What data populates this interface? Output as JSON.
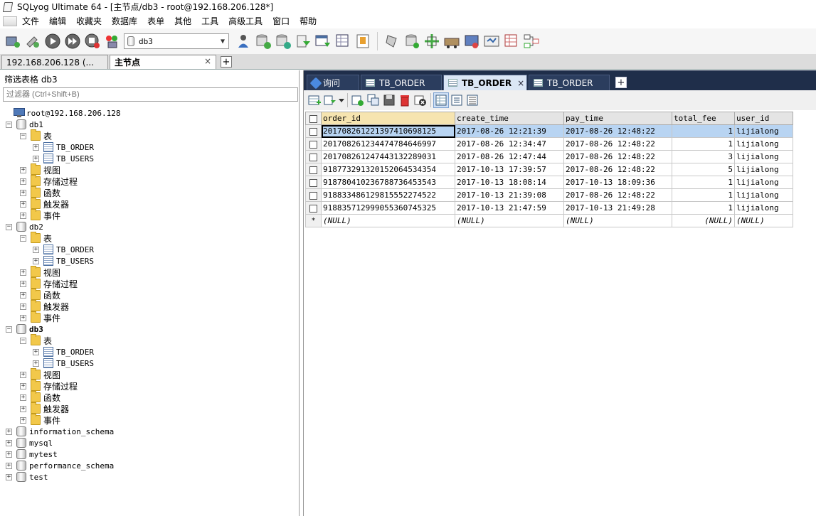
{
  "window": {
    "title": "SQLyog Ultimate 64 - [主节点/db3 - root@192.168.206.128*]"
  },
  "menu": [
    "文件",
    "编辑",
    "收藏夹",
    "数据库",
    "表单",
    "其他",
    "工具",
    "高级工具",
    "窗口",
    "帮助"
  ],
  "toolbar": {
    "db_select": "db3"
  },
  "connection_tabs": [
    {
      "label": "192.168.206.128 (...",
      "active": false
    },
    {
      "label": "主节点",
      "active": true,
      "close": "×"
    }
  ],
  "object_browser": {
    "filter_label": "筛选表格 db3",
    "filter_placeholder": "过滤器 (Ctrl+Shift+B)",
    "root": "root@192.168.206.128",
    "databases": [
      {
        "name": "db1",
        "expanded": true,
        "bold": false
      },
      {
        "name": "db2",
        "expanded": true,
        "bold": false
      },
      {
        "name": "db3",
        "expanded": true,
        "bold": true
      },
      {
        "name": "information_schema",
        "expanded": false
      },
      {
        "name": "mysql",
        "expanded": false
      },
      {
        "name": "mytest",
        "expanded": false
      },
      {
        "name": "performance_schema",
        "expanded": false
      },
      {
        "name": "test",
        "expanded": false
      }
    ],
    "tables_folder": "表",
    "tables": [
      "TB_ORDER",
      "TB_USERS"
    ],
    "folders": [
      "视图",
      "存储过程",
      "函数",
      "触发器",
      "事件"
    ]
  },
  "query_tabs": [
    {
      "label": "询问",
      "type": "query"
    },
    {
      "label": "TB_ORDER",
      "type": "table"
    },
    {
      "label": "TB_ORDER",
      "type": "table",
      "active": true,
      "close": "×"
    },
    {
      "label": "TB_ORDER",
      "type": "table"
    }
  ],
  "grid": {
    "columns": [
      "order_id",
      "create_time",
      "pay_time",
      "total_fee",
      "user_id"
    ],
    "rows": [
      [
        "201708261221397410698125",
        "2017-08-26 12:21:39",
        "2017-08-26 12:48:22",
        "1",
        "lijialong"
      ],
      [
        "201708261234474784646997",
        "2017-08-26 12:34:47",
        "2017-08-26 12:48:22",
        "1",
        "lijialong"
      ],
      [
        "201708261247443132289031",
        "2017-08-26 12:47:44",
        "2017-08-26 12:48:22",
        "3",
        "lijialong"
      ],
      [
        "918773291320152064534354",
        "2017-10-13 17:39:57",
        "2017-08-26 12:48:22",
        "5",
        "lijialong"
      ],
      [
        "918780410236788736453543",
        "2017-10-13 18:08:14",
        "2017-10-13 18:09:36",
        "1",
        "lijialong"
      ],
      [
        "918833486129815552274522",
        "2017-10-13 21:39:08",
        "2017-08-26 12:48:22",
        "1",
        "lijialong"
      ],
      [
        "918835712999055360745325",
        "2017-10-13 21:47:59",
        "2017-10-13 21:49:28",
        "1",
        "lijialong"
      ]
    ],
    "new_row_marker": "*",
    "null_text": "(NULL)"
  }
}
